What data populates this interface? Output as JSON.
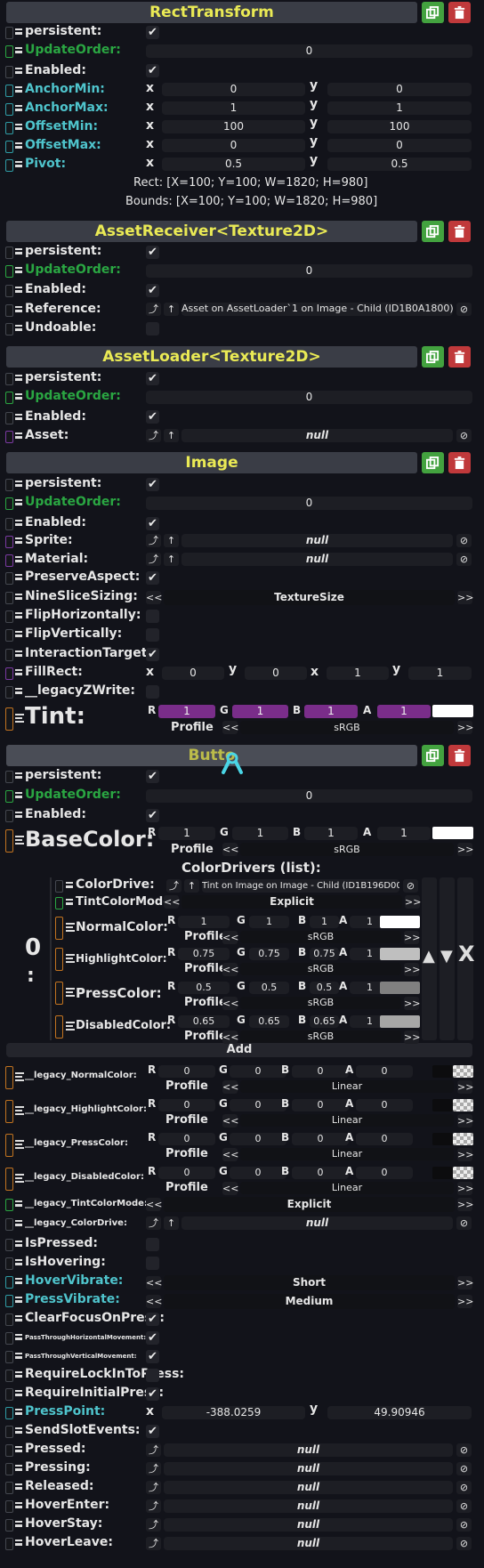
{
  "rect": {
    "title": "RectTransform",
    "persistent": "persistent:",
    "updateorder": "UpdateOrder:",
    "updateorder_val": "0",
    "enabled": "Enabled:",
    "anchormin": "AnchorMin:",
    "anchormax": "AnchorMax:",
    "offsetmin": "OffsetMin:",
    "offsetmax": "OffsetMax:",
    "pivot": "Pivot:",
    "anchormin_x": "0",
    "anchormin_y": "0",
    "anchormax_x": "1",
    "anchormax_y": "1",
    "offsetmin_x": "100",
    "offsetmin_y": "100",
    "offsetmax_x": "0",
    "offsetmax_y": "0",
    "pivot_x": "0.5",
    "pivot_y": "0.5",
    "rect_text": "Rect: [X=100; Y=100; W=1820; H=980]",
    "bounds_text": "Bounds: [X=100; Y=100; W=1820; H=980]"
  },
  "axis": {
    "x": "x",
    "y": "y",
    "r": "R",
    "g": "G",
    "b": "B",
    "a": "A",
    "profile": "Profile",
    "check": "✔",
    "set": "⤴",
    "up": "↑",
    "clear": "⊘",
    "left": "<<",
    "right": ">>"
  },
  "recv": {
    "title": "AssetReceiver<Texture2D>",
    "persistent": "persistent:",
    "updateorder": "UpdateOrder:",
    "updateorder_val": "0",
    "enabled": "Enabled:",
    "reference": "Reference:",
    "reference_val": "Asset on AssetLoader`1 on Image - Child (ID1B0A1800)",
    "undoable": "Undoable:"
  },
  "loader": {
    "title": "AssetLoader<Texture2D>",
    "persistent": "persistent:",
    "updateorder": "UpdateOrder:",
    "updateorder_val": "0",
    "enabled": "Enabled:",
    "asset": "Asset:",
    "asset_val": "null"
  },
  "image": {
    "title": "Image",
    "persistent": "persistent:",
    "updateorder": "UpdateOrder:",
    "updateorder_val": "0",
    "enabled": "Enabled:",
    "sprite": "Sprite:",
    "sprite_val": "null",
    "material": "Material:",
    "material_val": "null",
    "preserve": "PreserveAspect:",
    "nineslice": "NineSliceSizing:",
    "nineslice_val": "TextureSize",
    "fliph": "FlipHorizontally:",
    "flipv": "FlipVertically:",
    "interaction": "InteractionTarget:",
    "fillrect": "FillRect:",
    "fill_x1": "0",
    "fill_y1": "0",
    "fill_x2": "1",
    "fill_y2": "1",
    "legacyz": "__legacyZWrite:",
    "tint": "Tint:",
    "tint_r": "1",
    "tint_g": "1",
    "tint_b": "1",
    "tint_a": "1",
    "tint_profile": "sRGB"
  },
  "button": {
    "title": "Butto",
    "persistent": "persistent:",
    "updateorder": "UpdateOrder:",
    "updateorder_val": "0",
    "enabled": "Enabled:",
    "basecolor": "BaseColor:",
    "base_r": "1",
    "base_g": "1",
    "base_b": "1",
    "base_a": "1",
    "base_profile": "sRGB",
    "colordrivers": "ColorDrivers (list):",
    "index": "0",
    "index_colon": ":",
    "colordrive": "ColorDrive:",
    "colordrive_val": "Tint on Image on Image - Child (ID1B196D00)",
    "tintmode": "TintColorMode:",
    "tintmode_val": "Explicit",
    "normal": "NormalColor:",
    "highlight": "HighlightColor:",
    "press": "PressColor:",
    "disabled": "DisabledColor:",
    "normal_v": [
      "1",
      "1",
      "1",
      "1"
    ],
    "highlight_v": [
      "0.75",
      "0.75",
      "0.75",
      "1"
    ],
    "press_v": [
      "0.5",
      "0.5",
      "0.5",
      "1"
    ],
    "disabled_v": [
      "0.65",
      "0.65",
      "0.65",
      "1"
    ],
    "srgb": "sRGB",
    "add": "Add",
    "lnormal": "__legacy_NormalColor:",
    "lhighlight": "__legacy_HighlightColor:",
    "lpress": "__legacy_PressColor:",
    "ldisabled": "__legacy_DisabledColor:",
    "zero": "0",
    "linear": "Linear",
    "ltintmode": "__legacy_TintColorMode:",
    "ltintmode_val": "Explicit",
    "lcolordrive": "__legacy_ColorDrive:",
    "lcolordrive_val": "null",
    "ispressed": "IsPressed:",
    "ishovering": "IsHovering:",
    "hovervibrate": "HoverVibrate:",
    "hovervibrate_val": "Short",
    "pressvibrate": "PressVibrate:",
    "pressvibrate_val": "Medium",
    "clearfocus": "ClearFocusOnPress:",
    "passh": "PassThroughHorizontalMovement:",
    "passv": "PassThroughVerticalMovement:",
    "requirelock": "RequireLockInToPress:",
    "requireinitial": "RequireInitialPress:",
    "presspoint": "PressPoint:",
    "presspoint_x": "-388.0259",
    "presspoint_y": "49.90946",
    "sendslot": "SendSlotEvents:",
    "pressed": "Pressed:",
    "pressing": "Pressing:",
    "released": "Released:",
    "hoverenter": "HoverEnter:",
    "hoverstay": "HoverStay:",
    "hoverleave": "HoverLeave:",
    "nullv": "null"
  },
  "colors": {
    "header_text": "#eaea55",
    "header_bg": "#3a3d46",
    "duplicate": "#43a23f",
    "delete": "#c0393b",
    "channel": "#7a2d8a"
  }
}
